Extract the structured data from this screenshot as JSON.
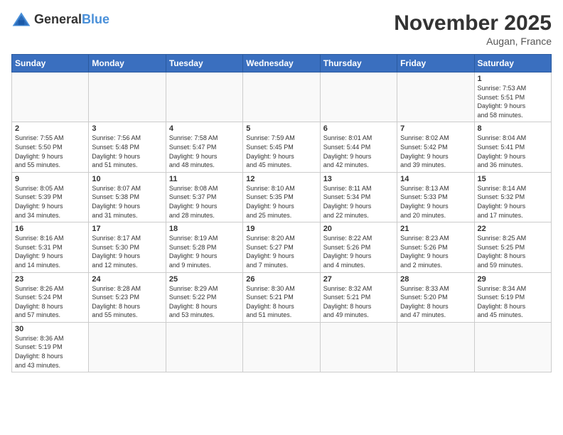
{
  "header": {
    "logo_general": "General",
    "logo_blue": "Blue",
    "month_title": "November 2025",
    "location": "Augan, France"
  },
  "weekdays": [
    "Sunday",
    "Monday",
    "Tuesday",
    "Wednesday",
    "Thursday",
    "Friday",
    "Saturday"
  ],
  "weeks": [
    [
      {
        "day": "",
        "info": ""
      },
      {
        "day": "",
        "info": ""
      },
      {
        "day": "",
        "info": ""
      },
      {
        "day": "",
        "info": ""
      },
      {
        "day": "",
        "info": ""
      },
      {
        "day": "",
        "info": ""
      },
      {
        "day": "1",
        "info": "Sunrise: 7:53 AM\nSunset: 5:51 PM\nDaylight: 9 hours\nand 58 minutes."
      }
    ],
    [
      {
        "day": "2",
        "info": "Sunrise: 7:55 AM\nSunset: 5:50 PM\nDaylight: 9 hours\nand 55 minutes."
      },
      {
        "day": "3",
        "info": "Sunrise: 7:56 AM\nSunset: 5:48 PM\nDaylight: 9 hours\nand 51 minutes."
      },
      {
        "day": "4",
        "info": "Sunrise: 7:58 AM\nSunset: 5:47 PM\nDaylight: 9 hours\nand 48 minutes."
      },
      {
        "day": "5",
        "info": "Sunrise: 7:59 AM\nSunset: 5:45 PM\nDaylight: 9 hours\nand 45 minutes."
      },
      {
        "day": "6",
        "info": "Sunrise: 8:01 AM\nSunset: 5:44 PM\nDaylight: 9 hours\nand 42 minutes."
      },
      {
        "day": "7",
        "info": "Sunrise: 8:02 AM\nSunset: 5:42 PM\nDaylight: 9 hours\nand 39 minutes."
      },
      {
        "day": "8",
        "info": "Sunrise: 8:04 AM\nSunset: 5:41 PM\nDaylight: 9 hours\nand 36 minutes."
      }
    ],
    [
      {
        "day": "9",
        "info": "Sunrise: 8:05 AM\nSunset: 5:39 PM\nDaylight: 9 hours\nand 34 minutes."
      },
      {
        "day": "10",
        "info": "Sunrise: 8:07 AM\nSunset: 5:38 PM\nDaylight: 9 hours\nand 31 minutes."
      },
      {
        "day": "11",
        "info": "Sunrise: 8:08 AM\nSunset: 5:37 PM\nDaylight: 9 hours\nand 28 minutes."
      },
      {
        "day": "12",
        "info": "Sunrise: 8:10 AM\nSunset: 5:35 PM\nDaylight: 9 hours\nand 25 minutes."
      },
      {
        "day": "13",
        "info": "Sunrise: 8:11 AM\nSunset: 5:34 PM\nDaylight: 9 hours\nand 22 minutes."
      },
      {
        "day": "14",
        "info": "Sunrise: 8:13 AM\nSunset: 5:33 PM\nDaylight: 9 hours\nand 20 minutes."
      },
      {
        "day": "15",
        "info": "Sunrise: 8:14 AM\nSunset: 5:32 PM\nDaylight: 9 hours\nand 17 minutes."
      }
    ],
    [
      {
        "day": "16",
        "info": "Sunrise: 8:16 AM\nSunset: 5:31 PM\nDaylight: 9 hours\nand 14 minutes."
      },
      {
        "day": "17",
        "info": "Sunrise: 8:17 AM\nSunset: 5:30 PM\nDaylight: 9 hours\nand 12 minutes."
      },
      {
        "day": "18",
        "info": "Sunrise: 8:19 AM\nSunset: 5:28 PM\nDaylight: 9 hours\nand 9 minutes."
      },
      {
        "day": "19",
        "info": "Sunrise: 8:20 AM\nSunset: 5:27 PM\nDaylight: 9 hours\nand 7 minutes."
      },
      {
        "day": "20",
        "info": "Sunrise: 8:22 AM\nSunset: 5:26 PM\nDaylight: 9 hours\nand 4 minutes."
      },
      {
        "day": "21",
        "info": "Sunrise: 8:23 AM\nSunset: 5:26 PM\nDaylight: 9 hours\nand 2 minutes."
      },
      {
        "day": "22",
        "info": "Sunrise: 8:25 AM\nSunset: 5:25 PM\nDaylight: 8 hours\nand 59 minutes."
      }
    ],
    [
      {
        "day": "23",
        "info": "Sunrise: 8:26 AM\nSunset: 5:24 PM\nDaylight: 8 hours\nand 57 minutes."
      },
      {
        "day": "24",
        "info": "Sunrise: 8:28 AM\nSunset: 5:23 PM\nDaylight: 8 hours\nand 55 minutes."
      },
      {
        "day": "25",
        "info": "Sunrise: 8:29 AM\nSunset: 5:22 PM\nDaylight: 8 hours\nand 53 minutes."
      },
      {
        "day": "26",
        "info": "Sunrise: 8:30 AM\nSunset: 5:21 PM\nDaylight: 8 hours\nand 51 minutes."
      },
      {
        "day": "27",
        "info": "Sunrise: 8:32 AM\nSunset: 5:21 PM\nDaylight: 8 hours\nand 49 minutes."
      },
      {
        "day": "28",
        "info": "Sunrise: 8:33 AM\nSunset: 5:20 PM\nDaylight: 8 hours\nand 47 minutes."
      },
      {
        "day": "29",
        "info": "Sunrise: 8:34 AM\nSunset: 5:19 PM\nDaylight: 8 hours\nand 45 minutes."
      }
    ],
    [
      {
        "day": "30",
        "info": "Sunrise: 8:36 AM\nSunset: 5:19 PM\nDaylight: 8 hours\nand 43 minutes."
      },
      {
        "day": "",
        "info": ""
      },
      {
        "day": "",
        "info": ""
      },
      {
        "day": "",
        "info": ""
      },
      {
        "day": "",
        "info": ""
      },
      {
        "day": "",
        "info": ""
      },
      {
        "day": "",
        "info": ""
      }
    ]
  ]
}
